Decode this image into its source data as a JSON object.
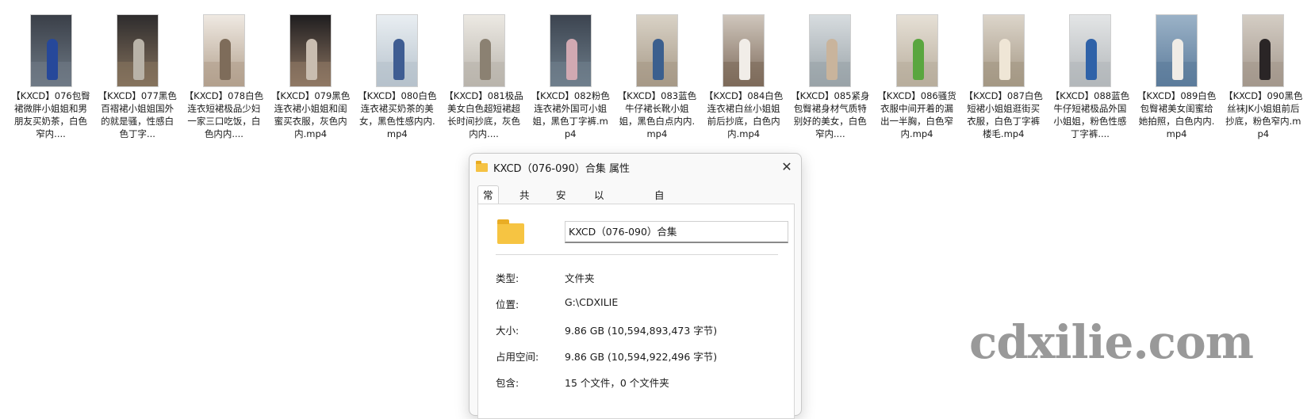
{
  "files": [
    {
      "label": "【KXCD】076包臀裙微胖小姐姐和男朋友买奶茶，白色窄内....",
      "colors": [
        "#6f7a86",
        "#3a3f48",
        "#26489a"
      ]
    },
    {
      "label": "【KXCD】077黑色百褶裙小姐姐国外的就是骚，性感白色丁字...",
      "colors": [
        "#86735e",
        "#2e2c2d",
        "#b9b3a8"
      ]
    },
    {
      "label": "【KXCD】078白色连衣短裙极品少妇一家三口吃饭，白色内内....",
      "colors": [
        "#b2a08d",
        "#efe9e2",
        "#7e6c5a"
      ]
    },
    {
      "label": "【KXCD】079黑色连衣裙小姐姐和闺蜜买衣服，灰色内内.mp4",
      "colors": [
        "#8f7864",
        "#1f1d1f",
        "#c9bdb0"
      ]
    },
    {
      "label": "【KXCD】080白色连衣裙买奶茶的美女，黑色性感内内.mp4",
      "colors": [
        "#b6c2cc",
        "#e9eef2",
        "#3f5d92"
      ]
    },
    {
      "label": "【KXCD】081极品美女白色超短裙超长时间抄底，灰色内内....",
      "colors": [
        "#b9b4ac",
        "#ece9e3",
        "#8b8172"
      ]
    },
    {
      "label": "【KXCD】082粉色连衣裙外国可小姐姐，黑色丁字裤.mp4",
      "colors": [
        "#6f7f8c",
        "#3c4450",
        "#d1a9b2"
      ]
    },
    {
      "label": "【KXCD】083蓝色牛仔裙长靴小姐姐，黑色白点内内.mp4",
      "colors": [
        "#a69987",
        "#d9d2c6",
        "#3b5f8e"
      ]
    },
    {
      "label": "【KXCD】084白色连衣裙白丝小姐姐前后抄底，白色内内.mp4",
      "colors": [
        "#7d6a5a",
        "#cfc6bc",
        "#f1ede8"
      ]
    },
    {
      "label": "【KXCD】085紧身包臀裙身材气质特别好的美女，白色窄内....",
      "colors": [
        "#9aa3a8",
        "#d7dcdf",
        "#c9b49c"
      ]
    },
    {
      "label": "【KXCD】086骚货衣服中间开着的漏出一半胸，白色窄内.mp4",
      "colors": [
        "#b8ad9c",
        "#e6e0d6",
        "#5aa63f"
      ]
    },
    {
      "label": "【KXCD】087白色短裙小姐姐逛街买衣服，白色丁字裤楼毛.mp4",
      "colors": [
        "#a49784",
        "#dcd5ca",
        "#efe6d6"
      ]
    },
    {
      "label": "【KXCD】088蓝色牛仔短裙极品外国小姐姐，粉色性感丁字裤....",
      "colors": [
        "#b3b7ba",
        "#e3e5e6",
        "#2f62a8"
      ]
    },
    {
      "label": "【KXCD】089白色包臀裙美女闺蜜给她拍照，白色内内.mp4",
      "colors": [
        "#5b7b9b",
        "#9bb2c7",
        "#f0ece6"
      ]
    },
    {
      "label": "【KXCD】090黑色丝袜JK小姐姐前后抄底，粉色窄内.mp4",
      "colors": [
        "#a3978c",
        "#d4cdc4",
        "#2a2526"
      ]
    }
  ],
  "dialog": {
    "title": "KXCD（076-090）合集 属性",
    "close_glyph": "✕",
    "tabs": [
      "常规",
      "共享",
      "安全",
      "以前的版本",
      "自定义"
    ],
    "folder_name": "KXCD（076-090）合集",
    "props": [
      {
        "label": "类型:",
        "value": "文件夹"
      },
      {
        "label": "位置:",
        "value": "G:\\CDXILIE"
      },
      {
        "label": "大小:",
        "value": "9.86 GB (10,594,893,473 字节)"
      },
      {
        "label": "占用空间:",
        "value": "9.86 GB (10,594,922,496 字节)"
      },
      {
        "label": "包含:",
        "value": "15 个文件，0 个文件夹"
      }
    ]
  },
  "watermark": "cdxilie.com"
}
